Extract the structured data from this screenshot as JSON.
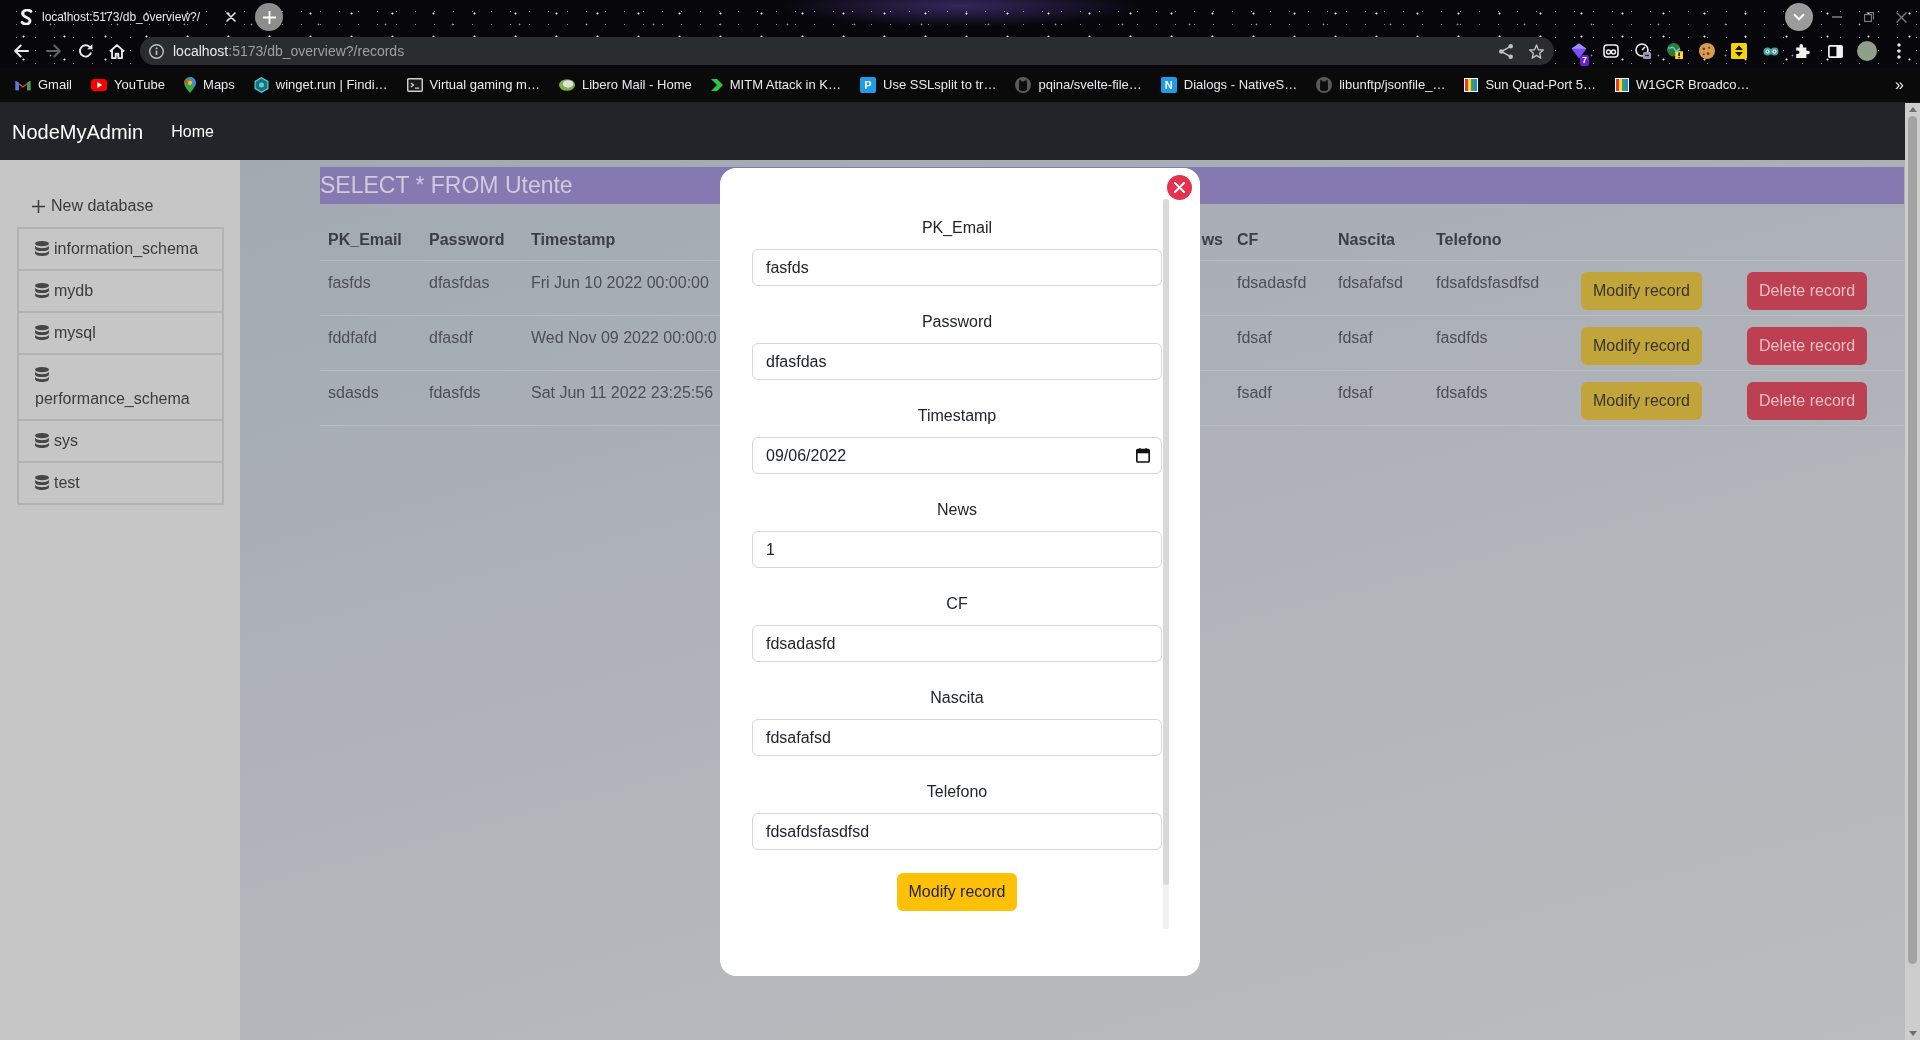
{
  "browser": {
    "tab": {
      "title": "localhost:5173/db_overview?/"
    },
    "back": {
      "disabled": false
    },
    "forward": {
      "disabled": true
    },
    "url": {
      "host": "localhost",
      "rest": ":5173/db_overview?/records"
    },
    "extension_badge": "7",
    "bookmarks": [
      {
        "label": "Gmail",
        "kind": "mail"
      },
      {
        "label": "YouTube",
        "kind": "video"
      },
      {
        "label": "Maps",
        "kind": "pin"
      },
      {
        "label": "winget.run | Findi…",
        "kind": "hexagon"
      },
      {
        "label": "Virtual gaming m…",
        "kind": "terminal"
      },
      {
        "label": "Libero Mail - Home",
        "kind": "cloud"
      },
      {
        "label": "MITM Attack in K…",
        "kind": "chevron"
      },
      {
        "label": "Use SSLsplit to tr…",
        "kind": "letter",
        "letter": "P"
      },
      {
        "label": "pqina/svelte-file…",
        "kind": "cat"
      },
      {
        "label": "Dialogs - NativeS…",
        "kind": "letter",
        "letter": "N"
      },
      {
        "label": "libunftp/jsonfile_…",
        "kind": "cat"
      },
      {
        "label": "Sun Quad-Port 5…",
        "kind": "bars"
      },
      {
        "label": "W1GCR Broadco…",
        "kind": "bars"
      }
    ],
    "overflow": "»"
  },
  "navbar": {
    "brand": "NodeMyAdmin",
    "links": [
      "Home"
    ]
  },
  "sidebar": {
    "new_database": "New database",
    "databases": [
      "information_schema",
      "mydb",
      "mysql",
      "performance_schema",
      "sys",
      "test"
    ]
  },
  "query": {
    "title": "SELECT * FROM Utente"
  },
  "table": {
    "columns": [
      {
        "heading": "PK_Email",
        "kind": "data"
      },
      {
        "heading": "Password",
        "kind": "data"
      },
      {
        "heading": "Timestamp",
        "kind": "data"
      },
      {
        "heading": "ws",
        "kind": "covered"
      },
      {
        "heading": "CF",
        "kind": "data"
      },
      {
        "heading": "Nascita",
        "kind": "data"
      },
      {
        "heading": "Telefono",
        "kind": "data"
      }
    ],
    "rows": [
      {
        "cells": [
          "fasfds",
          "dfasfdas",
          "Fri Jun 10 2022 00:00:00",
          "",
          "fdsadasfd",
          "fdsafafsd",
          "fdsafdsfasdfsd"
        ],
        "actions": [
          {
            "label": "Modify record",
            "kind": "modify"
          },
          {
            "label": "Delete record",
            "kind": "delete"
          }
        ]
      },
      {
        "cells": [
          "fddfafd",
          "dfasdf",
          "Wed Nov 09 2022 00:00:0",
          "",
          "fdsaf",
          "fdsaf",
          "fasdfds"
        ],
        "actions": [
          {
            "label": "Modify record",
            "kind": "modify"
          },
          {
            "label": "Delete record",
            "kind": "delete"
          }
        ]
      },
      {
        "cells": [
          "sdasds",
          "fdasfds",
          "Sat Jun 11 2022 23:25:56",
          "",
          "fsadf",
          "fdsaf",
          "fdsafds"
        ],
        "actions": [
          {
            "label": "Modify record",
            "kind": "modify"
          },
          {
            "label": "Delete record",
            "kind": "delete"
          }
        ]
      }
    ]
  },
  "modal": {
    "fields": [
      {
        "label": "PK_Email",
        "value": "fasfds",
        "kind": "text"
      },
      {
        "label": "Password",
        "value": "dfasfdas",
        "kind": "text"
      },
      {
        "label": "Timestamp",
        "value": "09/06/2022",
        "kind": "date"
      },
      {
        "label": "News",
        "value": "1",
        "kind": "text"
      },
      {
        "label": "CF",
        "value": "fdsadasfd",
        "kind": "text"
      },
      {
        "label": "Nascita",
        "value": "fdsafafsd",
        "kind": "text"
      },
      {
        "label": "Telefono",
        "value": "fdsafdsfasdfsd",
        "kind": "text"
      }
    ],
    "submit": "Modify record"
  }
}
